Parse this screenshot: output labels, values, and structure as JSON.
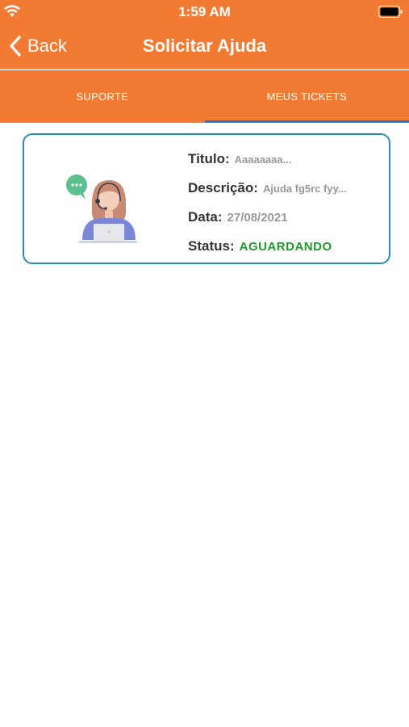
{
  "status_bar": {
    "time": "1:59 AM"
  },
  "nav": {
    "back_label": "Back",
    "title": "Solicitar Ajuda"
  },
  "tabs": [
    {
      "label": "SUPORTE",
      "active": false
    },
    {
      "label": "MEUS TICKETS",
      "active": true
    }
  ],
  "tickets": [
    {
      "titulo_label": "Titulo:",
      "titulo_value": "Aaaaaaaa...",
      "descricao_label": "Descrição:",
      "descricao_value": "Ajuda fg5rc fyy...",
      "data_label": "Data:",
      "data_value": "27/08/2021",
      "status_label": "Status:",
      "status_value": "AGUARDANDO",
      "status_color": "#1e9a2a"
    }
  ],
  "colors": {
    "primary": "#f37a32",
    "tab_indicator": "#2f6fd6",
    "card_border": "#2a8cb8"
  }
}
